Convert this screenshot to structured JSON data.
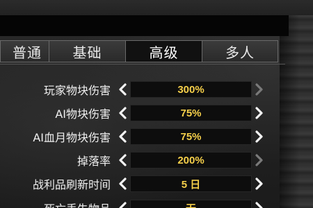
{
  "tabs": [
    {
      "label": "普通",
      "active": false
    },
    {
      "label": "基础",
      "active": false
    },
    {
      "label": "高级",
      "active": true
    },
    {
      "label": "多人",
      "active": false
    }
  ],
  "settings": [
    {
      "label": "玩家物块伤害",
      "value": "300%",
      "left_enabled": true,
      "right_enabled": false
    },
    {
      "label": "AI物块伤害",
      "value": "75%",
      "left_enabled": true,
      "right_enabled": true
    },
    {
      "label": "AI血月物块伤害",
      "value": "75%",
      "left_enabled": true,
      "right_enabled": true
    },
    {
      "label": "掉落率",
      "value": "200%",
      "left_enabled": true,
      "right_enabled": false
    },
    {
      "label": "战利品刷新时间",
      "value": "5 日",
      "left_enabled": true,
      "right_enabled": true
    },
    {
      "label": "死亡丢失物品",
      "value": "无",
      "left_enabled": true,
      "right_enabled": true
    }
  ],
  "colors": {
    "value_text": "#f5cf4a",
    "arrow_enabled": "#f2f2f2",
    "arrow_disabled": "#7a7a7a"
  }
}
